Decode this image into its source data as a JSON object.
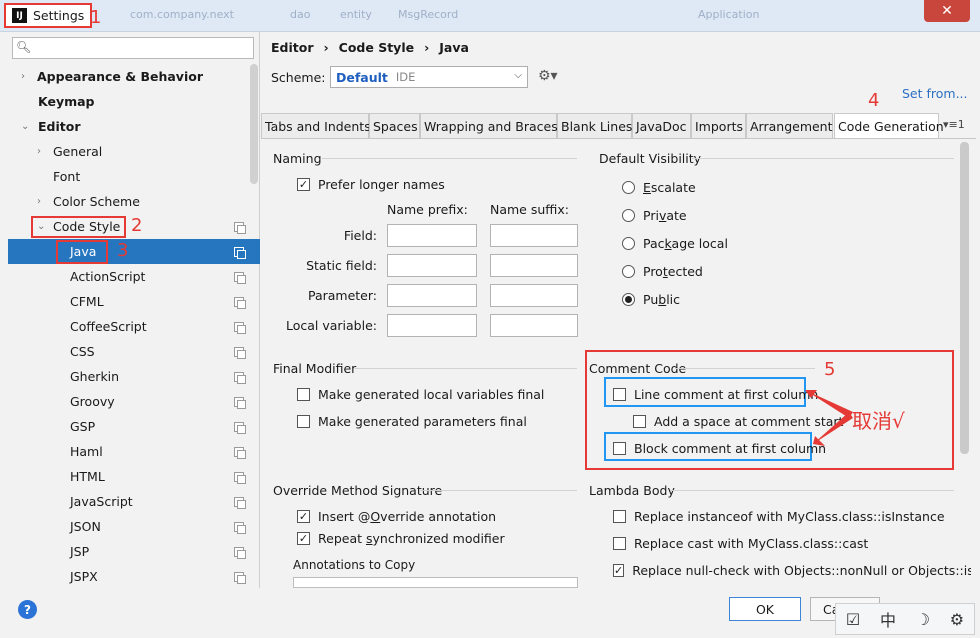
{
  "window": {
    "title": "Settings",
    "app_icon": "IJ",
    "close": "✕",
    "background_tabs": [
      "com.company.next",
      "dao",
      "entity",
      "MsgRecord",
      "Application"
    ]
  },
  "annotations": {
    "n1": "1",
    "n2": "2",
    "n3": "3",
    "n4": "4",
    "n5": "5",
    "cancel_note": "取消√"
  },
  "sidebar": {
    "search_placeholder": "",
    "items": [
      {
        "label": "Appearance & Behavior"
      },
      {
        "label": "Keymap"
      },
      {
        "label": "Editor"
      },
      {
        "label": "General"
      },
      {
        "label": "Font"
      },
      {
        "label": "Color Scheme"
      },
      {
        "label": "Code Style"
      },
      {
        "label": "Java"
      },
      {
        "label": "ActionScript"
      },
      {
        "label": "CFML"
      },
      {
        "label": "CoffeeScript"
      },
      {
        "label": "CSS"
      },
      {
        "label": "Gherkin"
      },
      {
        "label": "Groovy"
      },
      {
        "label": "GSP"
      },
      {
        "label": "Haml"
      },
      {
        "label": "HTML"
      },
      {
        "label": "JavaScript"
      },
      {
        "label": "JSON"
      },
      {
        "label": "JSP"
      },
      {
        "label": "JSPX"
      }
    ]
  },
  "header": {
    "breadcrumb": [
      "Editor",
      "›",
      "Code Style",
      "›",
      "Java"
    ],
    "scheme_label": "Scheme:",
    "scheme_name": "Default",
    "scheme_type": "IDE",
    "set_from": "Set from..."
  },
  "tabs": [
    "Tabs and Indents",
    "Spaces",
    "Wrapping and Braces",
    "Blank Lines",
    "JavaDoc",
    "Imports",
    "Arrangement",
    "Code Generation"
  ],
  "tabs_more": "▾≡1",
  "naming": {
    "title": "Naming",
    "prefer_longer": "Prefer longer names",
    "prefix_header": "Name prefix:",
    "suffix_header": "Name suffix:",
    "rows": [
      "Field:",
      "Static field:",
      "Parameter:",
      "Local variable:"
    ]
  },
  "visibility": {
    "title": "Default Visibility",
    "options": [
      {
        "pre": "",
        "mn": "E",
        "post": "scalate"
      },
      {
        "pre": "Pri",
        "mn": "v",
        "post": "ate"
      },
      {
        "pre": "Pac",
        "mn": "k",
        "post": "age local"
      },
      {
        "pre": "Pro",
        "mn": "t",
        "post": "ected"
      },
      {
        "pre": "Pu",
        "mn": "b",
        "post": "lic"
      }
    ],
    "selected": "Public"
  },
  "final_modifier": {
    "title": "Final Modifier",
    "local_vars": "Make generated local variables final",
    "params": "Make generated parameters final"
  },
  "comment_code": {
    "title": "Comment Code",
    "line_first": "Line comment at first column",
    "space_start": "Add a space at comment start",
    "block_first": "Block comment at first column"
  },
  "override": {
    "title": "Override Method Signature",
    "insert_pre": "Insert @",
    "insert_mn": "O",
    "insert_post": "verride annotation",
    "repeat_pre": "Repeat ",
    "repeat_mn": "s",
    "repeat_post": "ynchronized modifier",
    "annotations_to_copy": "Annotations to Copy"
  },
  "lambda": {
    "title": "Lambda Body",
    "instanceof": "Replace instanceof with MyClass.class::isInstance",
    "cast": "Replace cast with MyClass.class::cast",
    "nullcheck": "Replace null-check with Objects::nonNull or Objects::isNull"
  },
  "buttons": {
    "help": "?",
    "ok": "OK",
    "cancel": "Ca"
  },
  "ime": [
    "中",
    "☽",
    "⚙"
  ],
  "colors": {
    "accent_blue": "#2675bf",
    "annotation_red": "#e53935",
    "highlight_blue": "#2196f3"
  }
}
